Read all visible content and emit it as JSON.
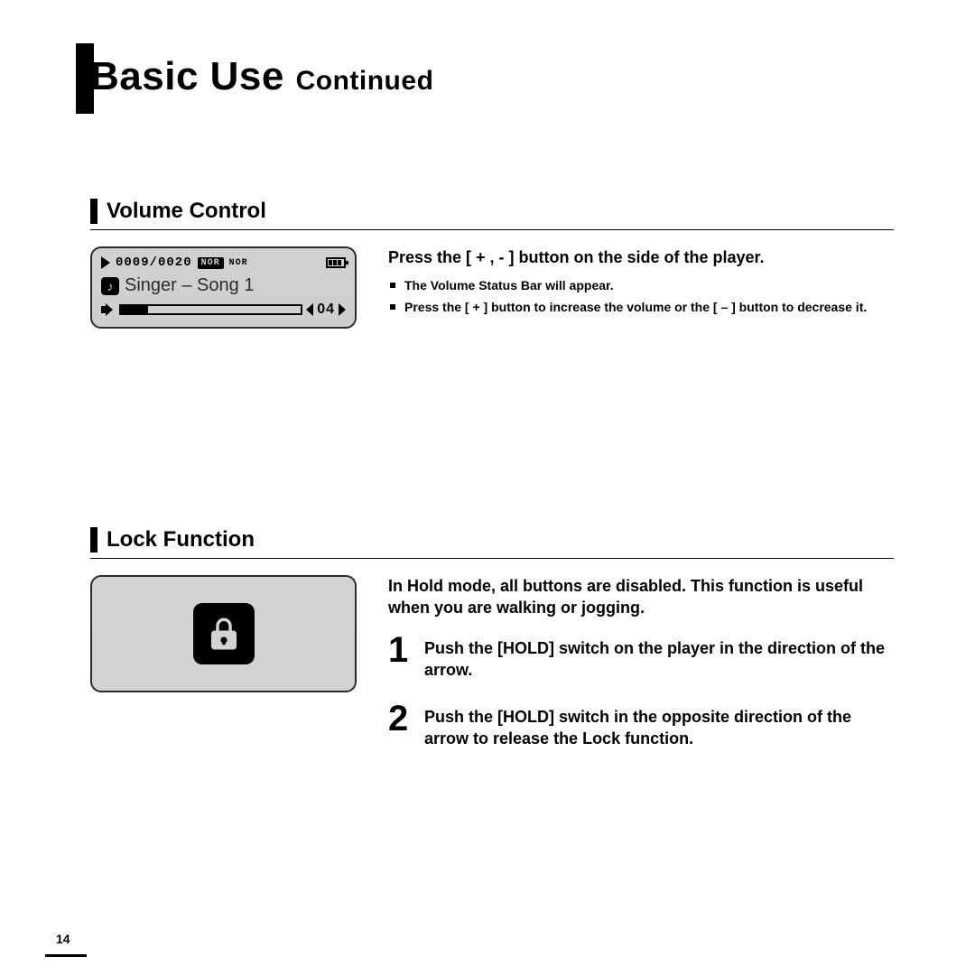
{
  "page_number": "14",
  "title_main": "Basic Use",
  "title_suffix": "Continued",
  "section1": {
    "heading": "Volume Control",
    "lead": "Press the [ + , - ] button on the side of the player.",
    "bullets": [
      "The Volume Status Bar will appear.",
      "Press the [ + ] button to increase the volume or the [ – ] button to decrease it."
    ],
    "lcd": {
      "counter": "0009/0020",
      "mode_badge": "NOR",
      "mode_text": "NOR",
      "track": "Singer – Song 1",
      "volume_value": "04"
    }
  },
  "section2": {
    "heading": "Lock Function",
    "lead": "In Hold mode, all buttons are disabled. This function is useful when you are walking or jogging.",
    "steps": [
      "Push the [HOLD] switch on the player in the direction of the arrow.",
      "Push the [HOLD] switch in the opposite direction of the arrow to release the Lock function."
    ]
  }
}
